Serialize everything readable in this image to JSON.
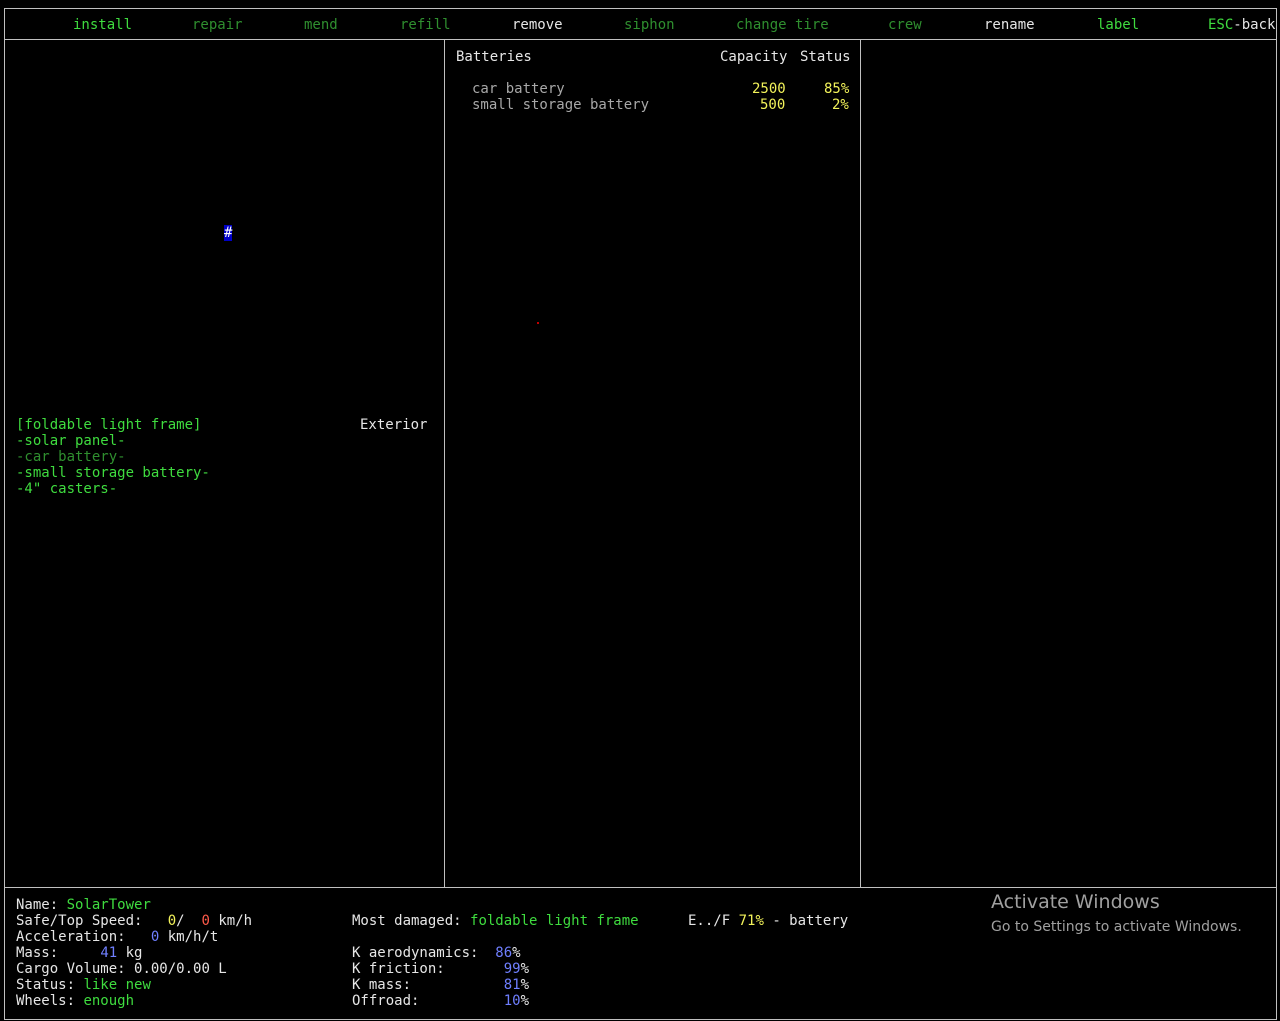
{
  "menu": {
    "install": "install",
    "repair": "repair",
    "mend": "mend",
    "refill": "refill",
    "remove": "remove",
    "siphon": "siphon",
    "change_tire": "change tire",
    "crew": "crew",
    "rename": "rename",
    "label": "label",
    "esc_key": "ESC",
    "esc_rest": "-back"
  },
  "map": {
    "cursor_symbol": "#"
  },
  "parts": {
    "header": "[foldable light frame]",
    "location": "Exterior",
    "items": [
      "-solar panel-",
      "-car battery-",
      "-small storage battery-",
      "-4\" casters-"
    ]
  },
  "batteries": {
    "title": "Batteries",
    "col_capacity": "Capacity",
    "col_status": "Status",
    "rows": [
      {
        "name": "car battery",
        "capacity": "2500",
        "status": "85%"
      },
      {
        "name": "small storage battery",
        "capacity": "500",
        "status": "2%"
      }
    ]
  },
  "stats": {
    "name_label": "Name:",
    "name_value": "SolarTower",
    "speed_label": "Safe/Top Speed:",
    "speed_safe": "0",
    "speed_sep": "/",
    "speed_top": "0",
    "speed_unit": "km/h",
    "accel_label": "Acceleration:",
    "accel_value": "0",
    "accel_unit": "km/h/t",
    "mass_label": "Mass:",
    "mass_value": "41",
    "mass_unit": "kg",
    "cargo_label": "Cargo Volume:",
    "cargo_value": "0.00/0.00 L",
    "status_label": "Status:",
    "status_value": "like new",
    "wheels_label": "Wheels:",
    "wheels_value": "enough",
    "damaged_label": "Most damaged:",
    "damaged_value": "foldable light frame",
    "fuel_prefix": "E../F",
    "fuel_value": "71%",
    "fuel_suffix": "- battery",
    "k_aero_label": "K aerodynamics:",
    "k_aero_value": "86",
    "k_friction_label": "K friction:",
    "k_friction_value": "99",
    "k_mass_label": "K mass:",
    "k_mass_value": "81",
    "offroad_label": "Offroad:",
    "offroad_value": "10",
    "percent": "%"
  },
  "watermark": {
    "title": "Activate Windows",
    "subtitle": "Go to Settings to activate Windows."
  },
  "colors": {
    "bright_green": "#3fdc3f",
    "dark_green": "#2f8f2f",
    "yellow": "#f2f25a",
    "blue": "#6f7fff",
    "red": "#ff5a4a",
    "border": "#c0c0c0"
  }
}
